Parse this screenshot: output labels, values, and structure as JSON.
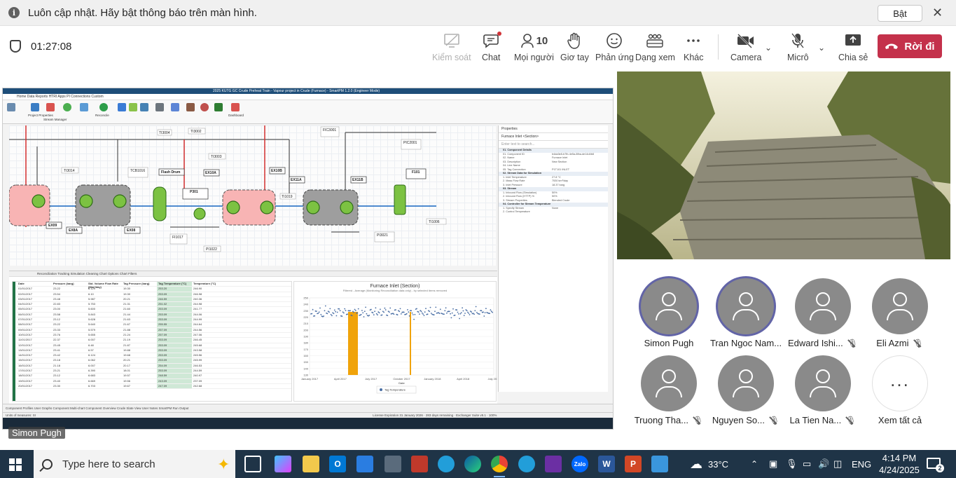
{
  "notification": {
    "message": "Luôn cập nhật. Hãy bật thông báo trên màn hình.",
    "enable_label": "Bật",
    "close_symbol": "✕"
  },
  "meeting": {
    "timer": "01:27:08",
    "controls": {
      "control_label": "Kiểm soát",
      "chat_label": "Chat",
      "people_label": "Mọi người",
      "people_count": "10",
      "raise_hand_label": "Giơ tay",
      "react_label": "Phản ứng",
      "view_label": "Dạng xem",
      "more_label": "Khác",
      "camera_label": "Camera",
      "mic_label": "Micrô",
      "share_label": "Chia sẻ",
      "leave_label": "Rời đi"
    },
    "colors": {
      "leave": "#c4314b",
      "ring": "#6264a7"
    }
  },
  "shared_screen": {
    "presenter_name": "Simon Pugh",
    "app_title": "2025 KUTG GC Crude Preheat Train - Vapour project in Crude (Furnace) - SmartPM 1.2.0 (Engineer Mode)",
    "ribbon_tabs": "Home   Data   Reports   HTRI Apps   PI Connections   Custom",
    "ribbon_groups": [
      "Project Properties",
      "Stream Manager",
      "Heat Exchanger Properties",
      "Offline Records",
      "Reconcile",
      "View",
      "Trend",
      "Auto Regulate",
      "Run Sensitivity",
      "Recommended",
      "Cleaning Planning",
      "Sensitivity Analysis",
      "Dashboard"
    ],
    "flowsheet_labels": {
      "flash_drum": "Flash Drum",
      "booster_pump": "P301 Booster Pump",
      "furnace": "F101 Furnace",
      "exchangers": [
        "EX09",
        "EX8A",
        "EX08",
        "EX10A",
        "EX10B",
        "EX11A",
        "EX11B"
      ],
      "tags": [
        "TI3004",
        "TI3002",
        "TI3003",
        "TI3014",
        "TCB1016",
        "TI1019",
        "FI1017",
        "TI1017",
        "PI1022",
        "FIC3001",
        "TI3001",
        "PIC2001",
        "TI1006",
        "PI3021"
      ]
    },
    "properties_panel": {
      "title": "Properties",
      "selected": "Furnace Inlet <Section>",
      "search_placeholder": "Enter text to search...",
      "rows": [
        {
          "k": "01. Component Details",
          "v": "",
          "sec": true
        },
        {
          "k": "01. Component ID",
          "v": "b4da3e8-b7fb-4e5a-8fba-de14d4b8",
          "sec": false
        },
        {
          "k": "02. Name",
          "v": "Furnace Inlet",
          "sec": false
        },
        {
          "k": "03. Description",
          "v": "New Section",
          "sec": false
        },
        {
          "k": "04. Line Name",
          "v": "",
          "sec": false
        },
        {
          "k": "05. Tag Connection",
          "v": "P1T101 INLET",
          "sec": false
        },
        {
          "k": "02. Stream Data for Simulation",
          "v": "",
          "sec": true
        },
        {
          "k": "1. Inlet Temperature",
          "v": "27.8 °C",
          "sec": false
        },
        {
          "k": "2. Mass Flow Rate",
          "v": "7530 km³/day",
          "sec": false
        },
        {
          "k": "3. Inlet Pressure",
          "v": "18.37 barg",
          "sec": false
        },
        {
          "k": "03. Stream",
          "v": "",
          "sec": true
        },
        {
          "k": "1. Inbound Flow (Simulation)",
          "v": "50%",
          "sec": false
        },
        {
          "k": "2. Inbound Flow (HTTP) %",
          "v": "50%",
          "sec": false
        },
        {
          "k": "3. Stream Properties",
          "v": "Blended Crude",
          "sec": false
        },
        {
          "k": "04. Controller for Stream Temperature",
          "v": "",
          "sec": true
        },
        {
          "k": "1. Specify Stream",
          "v": "None",
          "sec": false
        },
        {
          "k": "2. Control Temperature",
          "v": "",
          "sec": false
        }
      ]
    },
    "bottom_tabs": "Reconciliation   Tracking   Simulation   Cleaning   Chart Options   Chart Filters",
    "grid": {
      "columns": [
        "Date",
        "Pressure (barg)",
        "Std. Volume Flow Rate (Mm³/day)",
        "Tag Pressure (barg)",
        "Tag Temperature (°C)",
        "Temperature (°C)"
      ],
      "rows": [
        [
          "01/01/2017",
          "23.22",
          "6.129",
          "19.30",
          "253.20",
          "246.90"
        ],
        [
          "02/01/2017",
          "23.54",
          "6.10",
          "19.30",
          "253.09",
          "246.98"
        ],
        [
          "03/01/2017",
          "23.48",
          "5.987",
          "20.21",
          "246.59",
          "240.36"
        ],
        [
          "04/01/2017",
          "22.83",
          "5.753",
          "21.31",
          "251.02",
          "244.98"
        ],
        [
          "05/01/2017",
          "23.00",
          "5.600",
          "21.60",
          "253.09",
          "241.77"
        ],
        [
          "06/01/2017",
          "23.58",
          "5.843",
          "21.44",
          "253.09",
          "244.06"
        ],
        [
          "07/01/2017",
          "23.12",
          "5.628",
          "21.63",
          "253.09",
          "244.99"
        ],
        [
          "08/01/2017",
          "23.22",
          "5.640",
          "21.67",
          "255.55",
          "244.64"
        ],
        [
          "09/01/2017",
          "23.33",
          "5.579",
          "21.88",
          "257.09",
          "244.56"
        ],
        [
          "10/01/2017",
          "23.76",
          "5.655",
          "21.24",
          "257.09",
          "247.06"
        ],
        [
          "11/01/2017",
          "22.37",
          "6.007",
          "21.19",
          "253.09",
          "246.45"
        ],
        [
          "12/01/2017",
          "23.45",
          "6.48",
          "21.87",
          "253.09",
          "245.68"
        ],
        [
          "13/01/2017",
          "23.41",
          "6.57",
          "19.88",
          "253.09",
          "243.58"
        ],
        [
          "14/01/2017",
          "23.42",
          "6.124",
          "19.68",
          "253.09",
          "245.56"
        ],
        [
          "15/01/2017",
          "23.18",
          "6.062",
          "20.21",
          "253.09",
          "245.99"
        ],
        [
          "16/01/2017",
          "21.18",
          "6.007",
          "20.17",
          "254.09",
          "246.53"
        ],
        [
          "17/01/2017",
          "23.21",
          "6.390",
          "18.01",
          "253.09",
          "244.59"
        ],
        [
          "18/01/2017",
          "23.12",
          "6.683",
          "19.57",
          "248.59",
          "240.97"
        ],
        [
          "19/01/2017",
          "23.40",
          "6.669",
          "19.56",
          "243.09",
          "237.09"
        ],
        [
          "20/01/2017",
          "23.30",
          "6.703",
          "19.67",
          "247.09",
          "242.68"
        ]
      ]
    },
    "chart": {
      "title": "Furnace Inlet (Section)",
      "subtitle": "Filtered - Average (Monitoring Reconciliation data only) - by selected items removed",
      "x_ticks": [
        "January 2017",
        "April 2017",
        "July 2017",
        "October 2017",
        "January 2018",
        "April 2018",
        "July 2018"
      ],
      "y_ticks": [
        "250",
        "240",
        "230",
        "220",
        "210",
        "200",
        "190",
        "180",
        "170",
        "160",
        "150",
        "140",
        "130"
      ],
      "xlabel": "Date",
      "legend": "Tag Temperature",
      "point_color": "#4a6fa5",
      "marker_color": "#f0a30a"
    },
    "chart_data": {
      "type": "scatter",
      "title": "Furnace Inlet (Section)",
      "xlabel": "Date",
      "ylabel": "",
      "ylim": [
        130,
        250
      ],
      "series": [
        {
          "name": "Tag Temperature",
          "values": [
            228,
            226,
            230,
            224,
            222,
            227,
            231,
            225,
            223,
            229,
            233,
            227,
            222,
            219,
            224,
            230,
            235,
            228,
            225,
            226,
            229,
            232,
            227,
            223,
            225,
            228,
            231,
            226,
            224,
            227,
            230,
            234,
            229,
            225,
            222,
            226,
            229,
            233,
            228,
            226,
            224,
            227,
            231,
            229,
            226,
            223,
            227,
            230,
            232,
            228
          ]
        }
      ]
    },
    "status_bar": "Units of measures: SI",
    "status_right": "License Expiration 31 January 2026 · 283 days remaining · Exchanger Suite v9.1 · 100%",
    "sub_tabs": "Component Profiles   User Graphs   Component Multi-chart   Component Overview   Crude Slate View   User Notes   SmartPM Run Output"
  },
  "participants": [
    {
      "name": "Simon Pugh",
      "speaking": true,
      "muted": false
    },
    {
      "name": "Tran Ngoc Nam...",
      "speaking": true,
      "muted": false
    },
    {
      "name": "Edward Ishi...",
      "speaking": false,
      "muted": true
    },
    {
      "name": "Eli Azmi",
      "speaking": false,
      "muted": true
    },
    {
      "name": "Truong Tha...",
      "speaking": false,
      "muted": true
    },
    {
      "name": "Nguyen So...",
      "speaking": false,
      "muted": true
    },
    {
      "name": "La Tien Na...",
      "speaking": false,
      "muted": true
    },
    {
      "name": "Xem tất cả",
      "speaking": false,
      "muted": false
    }
  ],
  "taskbar": {
    "search_placeholder": "Type here to search",
    "weather": "33°C",
    "language": "ENG",
    "time": "4:14 PM",
    "date": "4/24/2025",
    "notification_count": "2"
  }
}
